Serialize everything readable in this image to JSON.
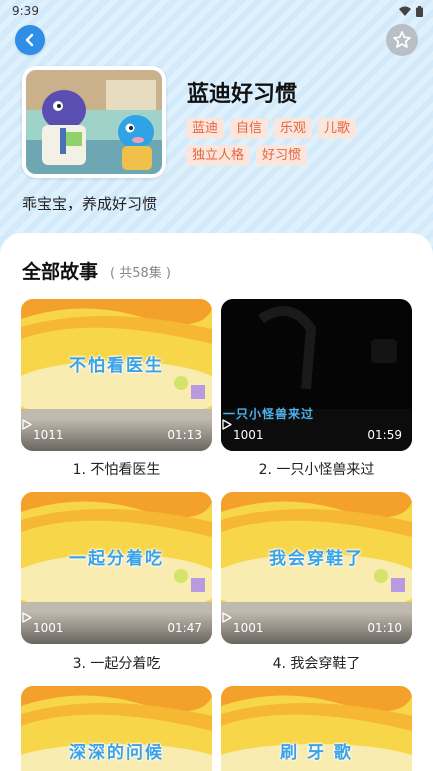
{
  "status_bar": {
    "time": "9:39"
  },
  "album": {
    "title": "蓝迪好习惯",
    "tags": [
      "蓝迪",
      "自信",
      "乐观",
      "儿歌",
      "独立人格",
      "好习惯"
    ],
    "description": "乖宝宝，养成好习惯"
  },
  "section": {
    "title": "全部故事",
    "count": "( 共58集 )"
  },
  "episodes": [
    {
      "art_title": "不怕看医生",
      "plays": "1011",
      "duration": "01:13",
      "caption": "1. 不怕看医生",
      "theme": "bright"
    },
    {
      "art_title": "一只小怪兽来过",
      "plays": "1001",
      "duration": "01:59",
      "caption": "2. 一只小怪兽来过",
      "theme": "dark"
    },
    {
      "art_title": "一起分着吃",
      "plays": "1001",
      "duration": "01:47",
      "caption": "3. 一起分着吃",
      "theme": "bright"
    },
    {
      "art_title": "我会穿鞋了",
      "plays": "1001",
      "duration": "01:10",
      "caption": "4. 我会穿鞋了",
      "theme": "bright"
    },
    {
      "art_title": "深深的问候",
      "theme": "bright"
    },
    {
      "art_title": "刷 牙 歌",
      "theme": "bright"
    }
  ],
  "colors": {
    "accent": "#2f8fe6",
    "tag_bg": "#fbe6dd",
    "tag_text": "#e6643c"
  },
  "icons": {
    "back": "chevron-left-icon",
    "favorite": "star-outline-icon",
    "play": "play-icon"
  }
}
